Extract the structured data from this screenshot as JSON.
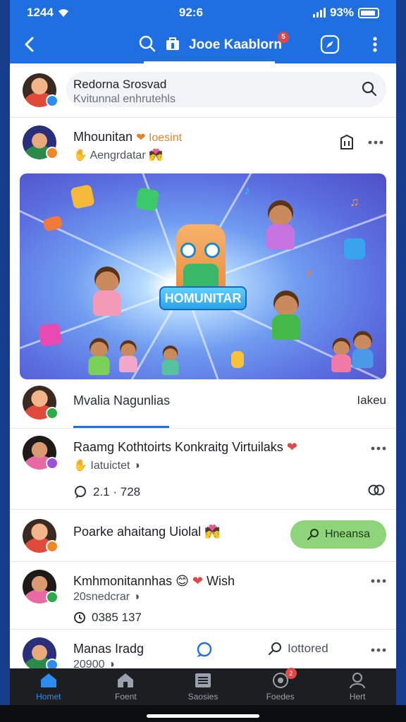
{
  "status_bar": {
    "time": "1244",
    "center": "92:6",
    "battery_pct": "93%"
  },
  "app_bar": {
    "title": "Jooe Kaablorn",
    "badge": "5"
  },
  "search": {
    "name": "Redorna Srosvad",
    "placeholder": "Kvitunnal enhrutehls"
  },
  "post": {
    "author": "Mhounitan",
    "tag": "Ioesint",
    "subtitle": "Aengrdatar",
    "banner_label": "HOMUNITAR"
  },
  "author_row": {
    "name": "Mvalia Nagunlias",
    "right_text": "Iakeu"
  },
  "comments": [
    {
      "name": "Raamg Kothtoirts Konkraitg Virtuilaks",
      "sub": "Iatuictet",
      "meta": "2.1 · 728"
    },
    {
      "name": "Poarke ahaitang Uiolal",
      "button": "Hneansa"
    },
    {
      "name": "Kmhmonitannhas",
      "wish": "Wish",
      "sub": "20snedcrar",
      "meta": "0385 137"
    },
    {
      "name": "Manas Iradg",
      "sub": "20900",
      "action": "Iottored"
    }
  ],
  "tabs": [
    {
      "label": "Homet",
      "icon": "home-icon",
      "active": true
    },
    {
      "label": "Foent",
      "icon": "house-outline-icon"
    },
    {
      "label": "Saosies",
      "icon": "list-icon"
    },
    {
      "label": "Foedes",
      "icon": "location-icon",
      "badge": "2"
    },
    {
      "label": "Hert",
      "icon": "profile-icon"
    }
  ],
  "colors": {
    "primary": "#1f6fe0",
    "follow_button": "#8fd37a",
    "badge": "#e04848"
  }
}
